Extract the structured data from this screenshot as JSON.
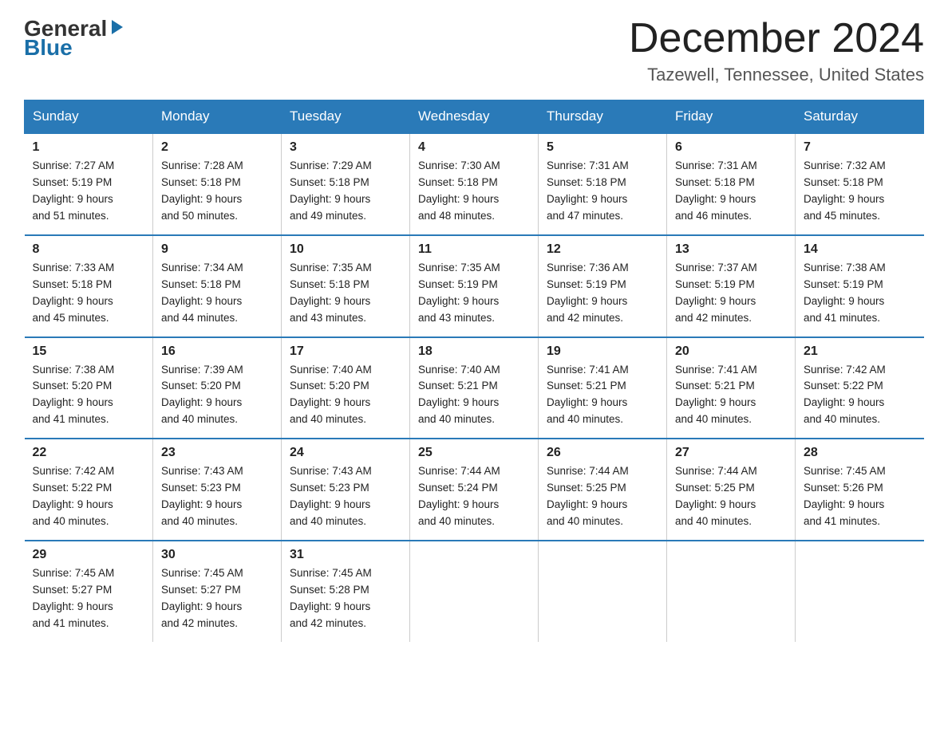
{
  "logo": {
    "general": "General",
    "blue": "Blue"
  },
  "title": "December 2024",
  "location": "Tazewell, Tennessee, United States",
  "days_of_week": [
    "Sunday",
    "Monday",
    "Tuesday",
    "Wednesday",
    "Thursday",
    "Friday",
    "Saturday"
  ],
  "weeks": [
    [
      {
        "day": "1",
        "sunrise": "7:27 AM",
        "sunset": "5:19 PM",
        "daylight": "9 hours and 51 minutes."
      },
      {
        "day": "2",
        "sunrise": "7:28 AM",
        "sunset": "5:18 PM",
        "daylight": "9 hours and 50 minutes."
      },
      {
        "day": "3",
        "sunrise": "7:29 AM",
        "sunset": "5:18 PM",
        "daylight": "9 hours and 49 minutes."
      },
      {
        "day": "4",
        "sunrise": "7:30 AM",
        "sunset": "5:18 PM",
        "daylight": "9 hours and 48 minutes."
      },
      {
        "day": "5",
        "sunrise": "7:31 AM",
        "sunset": "5:18 PM",
        "daylight": "9 hours and 47 minutes."
      },
      {
        "day": "6",
        "sunrise": "7:31 AM",
        "sunset": "5:18 PM",
        "daylight": "9 hours and 46 minutes."
      },
      {
        "day": "7",
        "sunrise": "7:32 AM",
        "sunset": "5:18 PM",
        "daylight": "9 hours and 45 minutes."
      }
    ],
    [
      {
        "day": "8",
        "sunrise": "7:33 AM",
        "sunset": "5:18 PM",
        "daylight": "9 hours and 45 minutes."
      },
      {
        "day": "9",
        "sunrise": "7:34 AM",
        "sunset": "5:18 PM",
        "daylight": "9 hours and 44 minutes."
      },
      {
        "day": "10",
        "sunrise": "7:35 AM",
        "sunset": "5:18 PM",
        "daylight": "9 hours and 43 minutes."
      },
      {
        "day": "11",
        "sunrise": "7:35 AM",
        "sunset": "5:19 PM",
        "daylight": "9 hours and 43 minutes."
      },
      {
        "day": "12",
        "sunrise": "7:36 AM",
        "sunset": "5:19 PM",
        "daylight": "9 hours and 42 minutes."
      },
      {
        "day": "13",
        "sunrise": "7:37 AM",
        "sunset": "5:19 PM",
        "daylight": "9 hours and 42 minutes."
      },
      {
        "day": "14",
        "sunrise": "7:38 AM",
        "sunset": "5:19 PM",
        "daylight": "9 hours and 41 minutes."
      }
    ],
    [
      {
        "day": "15",
        "sunrise": "7:38 AM",
        "sunset": "5:20 PM",
        "daylight": "9 hours and 41 minutes."
      },
      {
        "day": "16",
        "sunrise": "7:39 AM",
        "sunset": "5:20 PM",
        "daylight": "9 hours and 40 minutes."
      },
      {
        "day": "17",
        "sunrise": "7:40 AM",
        "sunset": "5:20 PM",
        "daylight": "9 hours and 40 minutes."
      },
      {
        "day": "18",
        "sunrise": "7:40 AM",
        "sunset": "5:21 PM",
        "daylight": "9 hours and 40 minutes."
      },
      {
        "day": "19",
        "sunrise": "7:41 AM",
        "sunset": "5:21 PM",
        "daylight": "9 hours and 40 minutes."
      },
      {
        "day": "20",
        "sunrise": "7:41 AM",
        "sunset": "5:21 PM",
        "daylight": "9 hours and 40 minutes."
      },
      {
        "day": "21",
        "sunrise": "7:42 AM",
        "sunset": "5:22 PM",
        "daylight": "9 hours and 40 minutes."
      }
    ],
    [
      {
        "day": "22",
        "sunrise": "7:42 AM",
        "sunset": "5:22 PM",
        "daylight": "9 hours and 40 minutes."
      },
      {
        "day": "23",
        "sunrise": "7:43 AM",
        "sunset": "5:23 PM",
        "daylight": "9 hours and 40 minutes."
      },
      {
        "day": "24",
        "sunrise": "7:43 AM",
        "sunset": "5:23 PM",
        "daylight": "9 hours and 40 minutes."
      },
      {
        "day": "25",
        "sunrise": "7:44 AM",
        "sunset": "5:24 PM",
        "daylight": "9 hours and 40 minutes."
      },
      {
        "day": "26",
        "sunrise": "7:44 AM",
        "sunset": "5:25 PM",
        "daylight": "9 hours and 40 minutes."
      },
      {
        "day": "27",
        "sunrise": "7:44 AM",
        "sunset": "5:25 PM",
        "daylight": "9 hours and 40 minutes."
      },
      {
        "day": "28",
        "sunrise": "7:45 AM",
        "sunset": "5:26 PM",
        "daylight": "9 hours and 41 minutes."
      }
    ],
    [
      {
        "day": "29",
        "sunrise": "7:45 AM",
        "sunset": "5:27 PM",
        "daylight": "9 hours and 41 minutes."
      },
      {
        "day": "30",
        "sunrise": "7:45 AM",
        "sunset": "5:27 PM",
        "daylight": "9 hours and 42 minutes."
      },
      {
        "day": "31",
        "sunrise": "7:45 AM",
        "sunset": "5:28 PM",
        "daylight": "9 hours and 42 minutes."
      },
      null,
      null,
      null,
      null
    ]
  ],
  "labels": {
    "sunrise": "Sunrise:",
    "sunset": "Sunset:",
    "daylight": "Daylight:"
  }
}
